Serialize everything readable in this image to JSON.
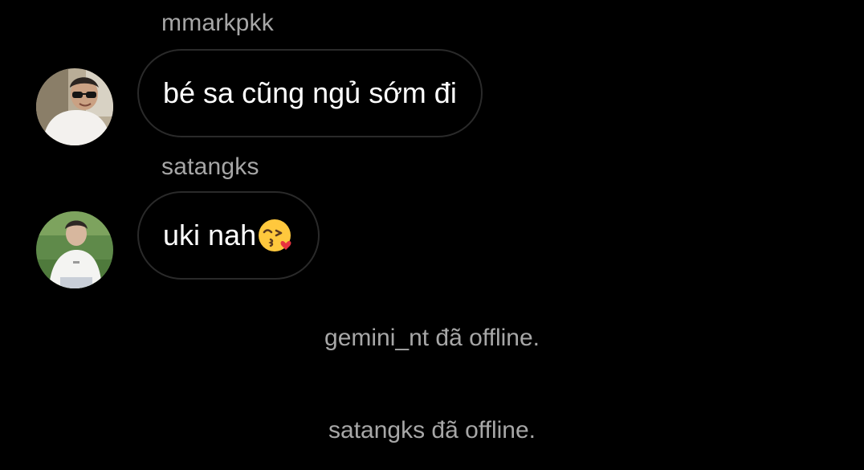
{
  "messages": [
    {
      "username": "mmarkpkk",
      "text": "bé sa cũng ngủ sớm đi",
      "avatar": "profile-photo-sunglasses"
    },
    {
      "username": "satangks",
      "text": "uki nah",
      "emoji": "kissing-face-with-heart-emoji",
      "avatar": "profile-photo-white-shirt-grass"
    }
  ],
  "system": [
    {
      "text": "gemini_nt đã offline."
    },
    {
      "text": "satangks đã offline."
    }
  ],
  "colors": {
    "background": "#000000",
    "bubble_border": "#2a2a2a",
    "message_text": "#ffffff",
    "secondary_text": "#a7a7a7"
  }
}
